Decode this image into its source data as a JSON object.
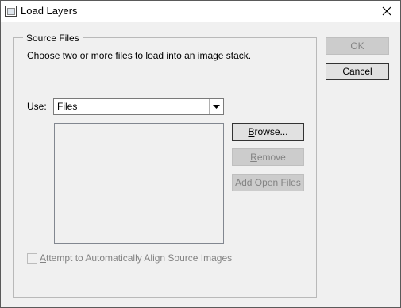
{
  "window": {
    "title": "Load Layers"
  },
  "group": {
    "legend": "Source Files",
    "instructions": "Choose two or more files to load into an image stack."
  },
  "use": {
    "label": "Use:",
    "selected": "Files"
  },
  "buttons": {
    "browse": {
      "pre": "",
      "accel": "B",
      "post": "rowse..."
    },
    "remove": {
      "pre": "",
      "accel": "R",
      "post": "emove"
    },
    "add_open_files": {
      "pre": "Add Open ",
      "accel": "F",
      "post": "iles"
    },
    "ok": "OK",
    "cancel": "Cancel"
  },
  "align_checkbox": {
    "pre": "",
    "accel": "A",
    "post": "ttempt to Automatically Align Source Images",
    "checked": false
  },
  "icons": {
    "app": "window-app-icon",
    "close": "close-icon",
    "dropdown": "chevron-down-icon"
  },
  "colors": {
    "dialog_bg": "#f0f0f0",
    "default_button_border": "#0078d7",
    "disabled_text": "#838383"
  }
}
